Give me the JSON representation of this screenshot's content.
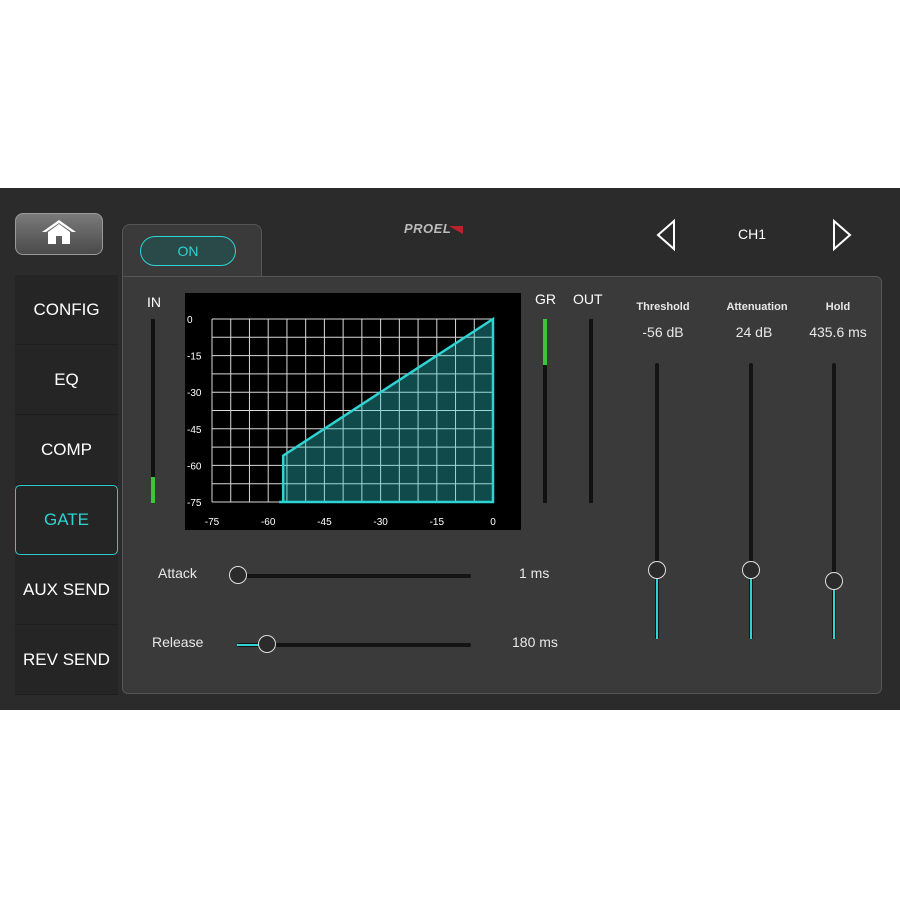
{
  "brand": "PROEL",
  "home_icon": "home-icon",
  "nav": {
    "items": [
      {
        "label": "CONFIG"
      },
      {
        "label": "EQ"
      },
      {
        "label": "COMP"
      },
      {
        "label": "GATE"
      },
      {
        "label": "AUX SEND"
      },
      {
        "label": "REV SEND"
      }
    ],
    "active": "GATE"
  },
  "tab": {
    "on_label": "ON"
  },
  "channel": {
    "label": "CH1",
    "prev_icon": "triangle-left-icon",
    "next_icon": "triangle-right-icon"
  },
  "meters": {
    "in_label": "IN",
    "gr_label": "GR",
    "out_label": "OUT",
    "in_level": 0.14,
    "gr_level": 0.25,
    "out_level": 0
  },
  "gate_graph": {
    "x_ticks": [
      "-75",
      "-60",
      "-45",
      "-30",
      "-15",
      "0"
    ],
    "y_ticks": [
      "0",
      "-15",
      "-30",
      "-45",
      "-60",
      "-75"
    ],
    "threshold_db": -56,
    "range_db": -75,
    "attenuation_db": 24
  },
  "attack": {
    "label": "Attack",
    "value": "1 ms",
    "position": 0.0
  },
  "release": {
    "label": "Release",
    "value": "180 ms",
    "position": 0.13
  },
  "faders": [
    {
      "title": "Threshold",
      "value": "-56 dB",
      "level": 0.25
    },
    {
      "title": "Attenuation",
      "value": "24 dB",
      "level": 0.25
    },
    {
      "title": "Hold",
      "value": "435.6 ms",
      "level": 0.21
    }
  ],
  "colors": {
    "accent": "#2fd3d3",
    "meter": "#3cc43c",
    "brand_red": "#c0202c"
  }
}
